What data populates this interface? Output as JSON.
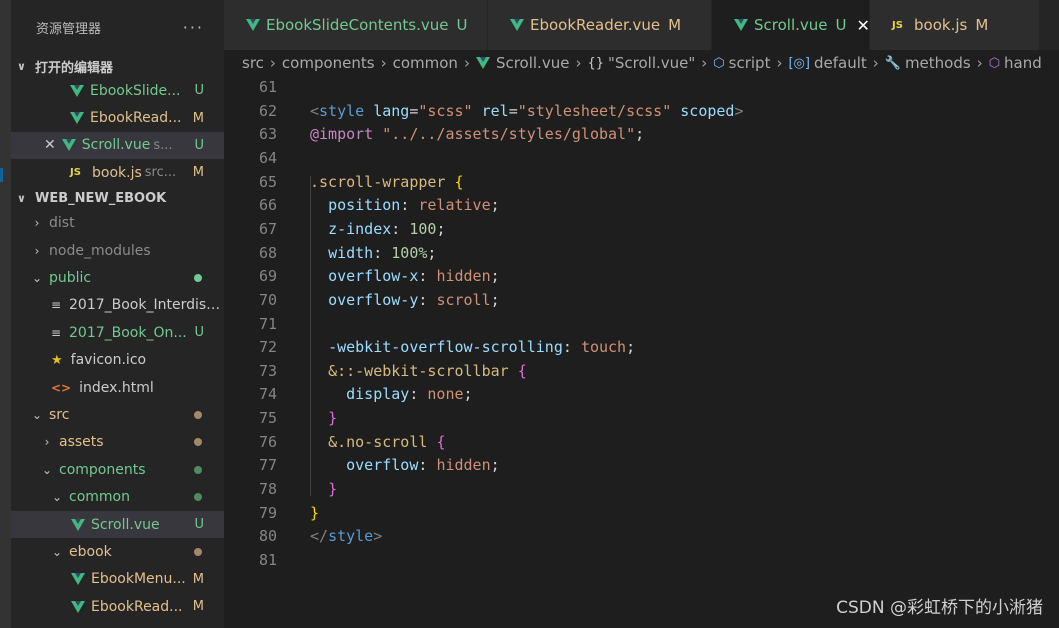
{
  "explorer": {
    "title": "资源管理器",
    "more": "···",
    "open_editors_title": "打开的编辑器",
    "open_editors": [
      {
        "name": "EbookSlide...",
        "badge": "U",
        "badge_color": "#73c991",
        "name_color": "#73c991",
        "icon": "vue"
      },
      {
        "name": "EbookRead...",
        "badge": "M",
        "badge_color": "#e2c08d",
        "name_color": "#e2c08d",
        "icon": "vue"
      },
      {
        "name": "Scroll.vue",
        "extra": "s...",
        "badge": "U",
        "badge_color": "#73c991",
        "name_color": "#73c991",
        "icon": "vue"
      },
      {
        "name": "book.js",
        "extra": "src...",
        "badge": "M",
        "badge_color": "#e2c08d",
        "name_color": "#e2c08d",
        "icon": "js"
      }
    ],
    "project_title": "WEB_NEW_EBOOK",
    "tree": [
      {
        "name": "dist",
        "indent": 0,
        "icon": "chevron-right",
        "color": "#8b8b8b"
      },
      {
        "name": "node_modules",
        "indent": 0,
        "icon": "chevron-right",
        "color": "#8b8b8b"
      },
      {
        "name": "public",
        "indent": 0,
        "icon": "chevron-down",
        "color": "#73c991",
        "dot": "#73c991"
      },
      {
        "name": "2017_Book_Interdisc...",
        "indent": 1,
        "icon": "lines",
        "color": "#cccccc"
      },
      {
        "name": "2017_Book_On...",
        "indent": 1,
        "icon": "lines",
        "color": "#73c991",
        "badge": "U",
        "badge_color": "#73c991"
      },
      {
        "name": "favicon.ico",
        "indent": 1,
        "icon": "star",
        "color": "#cccccc"
      },
      {
        "name": "index.html",
        "indent": 1,
        "icon": "html",
        "color": "#cccccc"
      },
      {
        "name": "src",
        "indent": 0,
        "icon": "chevron-down",
        "color": "#e2c08d",
        "dot": "#a08a6a"
      },
      {
        "name": "assets",
        "indent": 1,
        "icon": "chevron-right",
        "color": "#e2c08d",
        "dot": "#a08a6a"
      },
      {
        "name": "components",
        "indent": 1,
        "icon": "chevron-down",
        "color": "#73c991",
        "dot": "#4f8a61"
      },
      {
        "name": "common",
        "indent": 2,
        "icon": "chevron-down",
        "color": "#73c991",
        "dot": "#4f8a61"
      },
      {
        "name": "Scroll.vue",
        "indent": 3,
        "icon": "vue",
        "color": "#73c991",
        "badge": "U",
        "badge_color": "#73c991",
        "selected": true
      },
      {
        "name": "ebook",
        "indent": 2,
        "icon": "chevron-down",
        "color": "#e2c08d",
        "dot": "#a08a6a"
      },
      {
        "name": "EbookMenu...",
        "indent": 3,
        "icon": "vue",
        "color": "#e2c08d",
        "badge": "M",
        "badge_color": "#e2c08d"
      },
      {
        "name": "EbookRead...",
        "indent": 3,
        "icon": "vue",
        "color": "#e2c08d",
        "badge": "M",
        "badge_color": "#e2c08d"
      }
    ]
  },
  "tabs": [
    {
      "label": "EbookSlideContents.vue",
      "status": "U",
      "icon": "vue",
      "kind": "u"
    },
    {
      "label": "EbookReader.vue",
      "status": "M",
      "icon": "vue",
      "kind": "m"
    },
    {
      "label": "Scroll.vue",
      "status": "U",
      "icon": "vue",
      "kind": "u",
      "active": true,
      "close": "✕"
    },
    {
      "label": "book.js",
      "status": "M",
      "icon": "js",
      "kind": "m"
    }
  ],
  "breadcrumb": [
    "src",
    "components",
    "common",
    "Scroll.vue",
    "\"Scroll.vue\"",
    "script",
    "default",
    "methods",
    "hand"
  ],
  "code": {
    "line_numbers": [
      "61",
      "62",
      "63",
      "64",
      "65",
      "66",
      "67",
      "68",
      "69",
      "70",
      "71",
      "72",
      "73",
      "74",
      "75",
      "76",
      "77",
      "78",
      "79",
      "80",
      "81"
    ],
    "lines": [
      [],
      [
        [
          "t-tag",
          "<"
        ],
        [
          "t-el",
          "style"
        ],
        [
          "t-pun",
          " "
        ],
        [
          "t-attr",
          "lang"
        ],
        [
          "t-pun",
          "="
        ],
        [
          "t-str",
          "\"scss\""
        ],
        [
          "t-pun",
          " "
        ],
        [
          "t-attr",
          "rel"
        ],
        [
          "t-pun",
          "="
        ],
        [
          "t-str",
          "\"stylesheet/scss\""
        ],
        [
          "t-pun",
          " "
        ],
        [
          "t-attr",
          "scoped"
        ],
        [
          "t-tag",
          ">"
        ]
      ],
      [
        [
          "t-at",
          "@import"
        ],
        [
          "t-pun",
          " "
        ],
        [
          "t-str",
          "\"../../assets/styles/global\""
        ],
        [
          "t-pun",
          ";"
        ]
      ],
      [],
      [
        [
          "t-sel",
          ".scroll-wrapper"
        ],
        [
          "t-pun",
          " "
        ],
        [
          "t-b1",
          "{"
        ]
      ],
      [
        [
          "t-pun",
          "  "
        ],
        [
          "t-prop",
          "position"
        ],
        [
          "t-pun",
          ": "
        ],
        [
          "t-val",
          "relative"
        ],
        [
          "t-pun",
          ";"
        ]
      ],
      [
        [
          "t-pun",
          "  "
        ],
        [
          "t-prop",
          "z-index"
        ],
        [
          "t-pun",
          ": "
        ],
        [
          "t-num",
          "100"
        ],
        [
          "t-pun",
          ";"
        ]
      ],
      [
        [
          "t-pun",
          "  "
        ],
        [
          "t-prop",
          "width"
        ],
        [
          "t-pun",
          ": "
        ],
        [
          "t-num",
          "100%"
        ],
        [
          "t-pun",
          ";"
        ]
      ],
      [
        [
          "t-pun",
          "  "
        ],
        [
          "t-prop",
          "overflow-x"
        ],
        [
          "t-pun",
          ": "
        ],
        [
          "t-val",
          "hidden"
        ],
        [
          "t-pun",
          ";"
        ]
      ],
      [
        [
          "t-pun",
          "  "
        ],
        [
          "t-prop",
          "overflow-y"
        ],
        [
          "t-pun",
          ": "
        ],
        [
          "t-val",
          "scroll"
        ],
        [
          "t-pun",
          ";"
        ]
      ],
      [],
      [
        [
          "t-pun",
          "  "
        ],
        [
          "t-prop",
          "-webkit-overflow-scrolling"
        ],
        [
          "t-pun",
          ": "
        ],
        [
          "t-val",
          "touch"
        ],
        [
          "t-pun",
          ";"
        ]
      ],
      [
        [
          "t-pun",
          "  "
        ],
        [
          "t-sel",
          "&::-webkit-scrollbar"
        ],
        [
          "t-pun",
          " "
        ],
        [
          "t-b2",
          "{"
        ]
      ],
      [
        [
          "t-pun",
          "    "
        ],
        [
          "t-prop",
          "display"
        ],
        [
          "t-pun",
          ": "
        ],
        [
          "t-val",
          "none"
        ],
        [
          "t-pun",
          ";"
        ]
      ],
      [
        [
          "t-pun",
          "  "
        ],
        [
          "t-b2",
          "}"
        ]
      ],
      [
        [
          "t-pun",
          "  "
        ],
        [
          "t-sel",
          "&.no-scroll"
        ],
        [
          "t-pun",
          " "
        ],
        [
          "t-b2",
          "{"
        ]
      ],
      [
        [
          "t-pun",
          "    "
        ],
        [
          "t-prop",
          "overflow"
        ],
        [
          "t-pun",
          ": "
        ],
        [
          "t-val",
          "hidden"
        ],
        [
          "t-pun",
          ";"
        ]
      ],
      [
        [
          "t-pun",
          "  "
        ],
        [
          "t-b2",
          "}"
        ]
      ],
      [
        [
          "t-b1",
          "}"
        ]
      ],
      [
        [
          "t-tag",
          "</"
        ],
        [
          "t-el",
          "style"
        ],
        [
          "t-tag",
          ">"
        ]
      ],
      []
    ]
  },
  "watermark": "CSDN @彩虹桥下的小淅猪"
}
